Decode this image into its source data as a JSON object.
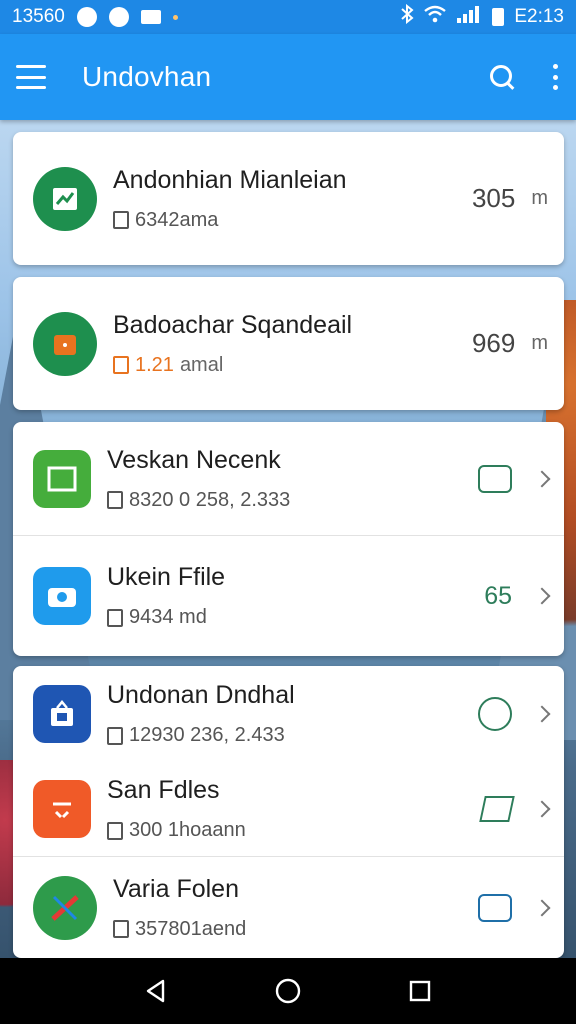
{
  "status_bar": {
    "time_left": "13560",
    "time_right": "E2:13"
  },
  "app_bar": {
    "title": "Undovhan",
    "menu_icon": "hamburger-menu-icon",
    "search_icon": "search-icon",
    "more_icon": "more-vert-icon"
  },
  "items": [
    {
      "title": "Andonhian Mianleian",
      "subtitle": "6342ama",
      "value": "305",
      "unit": "m",
      "icon_color": "#1e8f4e"
    },
    {
      "title": "Badoachar Sqandeail",
      "subtitle_value": "1.21",
      "subtitle_text": "amal",
      "value": "969",
      "unit": "m",
      "icon_color": "#1e8f4e"
    },
    {
      "title": "Veskan Necenk",
      "subtitle": "8320 0 258, 2.333",
      "icon_color": "#45ad3c"
    },
    {
      "title": "Ukein Ffile",
      "subtitle": "9434 md",
      "value": "65",
      "icon_color": "#1f9bec"
    },
    {
      "title": "Undonan Dndhal",
      "subtitle": "12930 236, 2.433",
      "icon_color": "#1f56b3"
    },
    {
      "title": "San Fdles",
      "subtitle": "300 1hoaann",
      "icon_color": "#f05a28"
    },
    {
      "title": "Varia Folen",
      "subtitle": "357801aend",
      "icon_color": "#2e9b4b"
    }
  ],
  "colors": {
    "status_bar": "#1e88e5",
    "app_bar": "#2196f3",
    "accent_green": "#2e7d5b",
    "accent_orange": "#e8731f"
  }
}
